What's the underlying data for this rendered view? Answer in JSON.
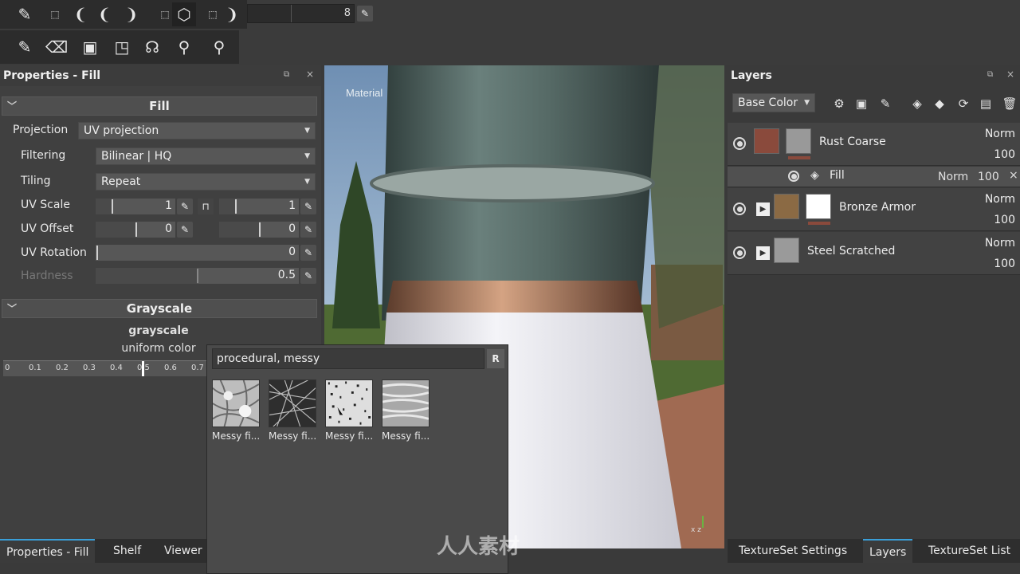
{
  "toolbar": {
    "brush_size": "8"
  },
  "properties": {
    "title": "Properties - Fill",
    "fill_section": "Fill",
    "projection_label": "Projection",
    "projection_value": "UV projection",
    "filtering_label": "Filtering",
    "filtering_value": "Bilinear | HQ",
    "tiling_label": "Tiling",
    "tiling_value": "Repeat",
    "uv_scale_label": "UV Scale",
    "uv_scale_u": "1",
    "uv_scale_v": "1",
    "uv_offset_label": "UV Offset",
    "uv_offset_u": "0",
    "uv_offset_v": "0",
    "uv_rotation_label": "UV Rotation",
    "uv_rotation_value": "0",
    "hardness_label": "Hardness",
    "hardness_value": "0.5",
    "grayscale_section": "Grayscale",
    "grayscale_name": "grayscale",
    "grayscale_type": "uniform color",
    "ruler_ticks": [
      "0",
      "0.1",
      "0.2",
      "0.3",
      "0.4",
      "0.5",
      "0.6",
      "0.7"
    ]
  },
  "viewport": {
    "label": "Material"
  },
  "popup": {
    "search_value": "procedural, messy",
    "reset_label": "R",
    "results": [
      "Messy fi...",
      "Messy fi...",
      "Messy fi...",
      "Messy fi..."
    ]
  },
  "layers": {
    "title": "Layers",
    "channel": "Base Color",
    "items": [
      {
        "name": "Rust Coarse",
        "blend": "Norm",
        "opacity": "100"
      },
      {
        "name": "Fill",
        "blend": "Norm",
        "opacity": "100"
      },
      {
        "name": "Bronze Armor",
        "blend": "Norm",
        "opacity": "100"
      },
      {
        "name": "Steel Scratched",
        "blend": "Norm",
        "opacity": "100"
      }
    ]
  },
  "tabs_left": [
    "Properties - Fill",
    "Shelf",
    "Viewer"
  ],
  "tabs_right": [
    "TextureSet Settings",
    "Layers",
    "TextureSet List"
  ],
  "watermark": "人人素材",
  "colors": {
    "accent": "#3a9fd8",
    "rust": "#8a4a3c"
  }
}
